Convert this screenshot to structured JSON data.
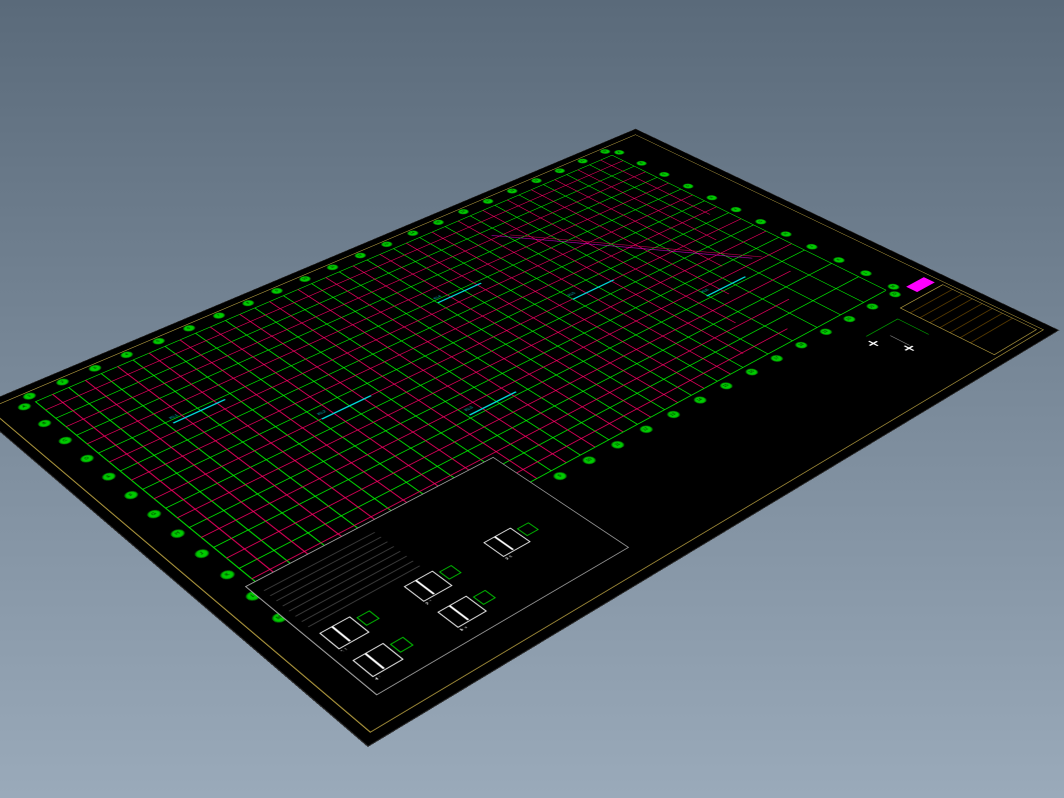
{
  "view": {
    "type": "3d-isometric",
    "background_gradient": [
      "#5a6a7a",
      "#9aaaba"
    ]
  },
  "drawing": {
    "type": "structural-plan",
    "sheet_background": "#000000",
    "frame_color": "#b8a040",
    "grid": {
      "axis_color": "#00ff00",
      "structural_line_color": "#ff0066",
      "diagonal_color": "#ff00ff",
      "beam_color": "#00dddd",
      "column_bubbles_horizontal": [
        "1",
        "2",
        "3",
        "4",
        "5",
        "6",
        "7",
        "8",
        "9",
        "10",
        "11",
        "12",
        "13",
        "14",
        "15",
        "16",
        "17",
        "18",
        "19",
        "20",
        "21",
        "22"
      ],
      "row_bubbles_vertical": [
        "A",
        "B",
        "C",
        "D",
        "E",
        "F",
        "G",
        "H",
        "J",
        "K",
        "L",
        "M"
      ],
      "horizontal_lines": 12,
      "vertical_lines": 22,
      "red_horizontal_lines": 11,
      "red_vertical_lines": 21,
      "has_diagonal_cutoff": true
    },
    "beam_labels": [
      "KL1",
      "KL2",
      "KL3",
      "KL4",
      "KL5",
      "KL6"
    ],
    "title_block": {
      "project": "",
      "drawing_title": "",
      "scale": "",
      "date": "",
      "drawn_by": "",
      "checked_by": "",
      "sheet_no": ""
    },
    "detail_sheet": {
      "title": "",
      "sections": [
        "1-1",
        "2-2",
        "3-3",
        "4-4",
        "5-5"
      ],
      "notes_lines": 8
    }
  }
}
